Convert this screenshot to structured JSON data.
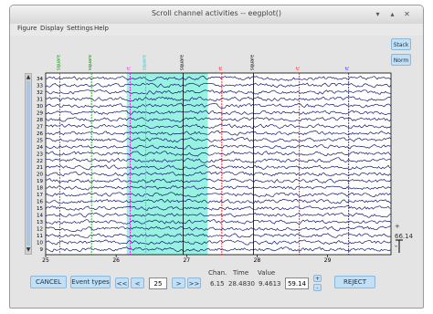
{
  "window": {
    "title": "Scroll channel activities -- eegplot()",
    "minimize": "▾",
    "maximize": "▴",
    "close": "✕"
  },
  "menu": [
    "Figure",
    "Display",
    "Settings",
    "Help"
  ],
  "events": [
    {
      "label": "square",
      "time": 25.2,
      "color": "#00a000"
    },
    {
      "label": "square",
      "time": 25.65,
      "color": "#00a000"
    },
    {
      "label": "rt",
      "time": 26.2,
      "color": "#ff00ff"
    },
    {
      "label": "square",
      "time": 26.42,
      "color": "#3ac8c8"
    },
    {
      "label": "square",
      "time": 26.95,
      "color": "#000000"
    },
    {
      "label": "rt",
      "time": 27.5,
      "color": "#ff0000"
    },
    {
      "label": "square",
      "time": 27.95,
      "color": "#000000"
    },
    {
      "label": "rt",
      "time": 28.6,
      "color": "#ff0000"
    },
    {
      "label": "rt",
      "time": 29.3,
      "color": "#0000ff"
    }
  ],
  "channels": [
    "34",
    "33",
    "32",
    "31",
    "30",
    "29",
    "28",
    "27",
    "26",
    "25",
    "24",
    "23",
    "22",
    "21",
    "20",
    "19",
    "18",
    "17",
    "16",
    "15",
    "14",
    "13",
    "12",
    "11",
    "10",
    "9"
  ],
  "x_axis": {
    "ticks": [
      "25",
      "26",
      "27",
      "28",
      "29"
    ],
    "range": [
      25,
      29.9
    ]
  },
  "selection": {
    "start": 26.15,
    "end": 27.3,
    "color": "#86f0dc"
  },
  "side_buttons": {
    "norm": "Norm",
    "stack": "Stack"
  },
  "scale": {
    "value": "66.14",
    "plus": "+",
    "minus": "-"
  },
  "bottom": {
    "cancel": "CANCEL",
    "event_types": "Event types",
    "nav": [
      "<<",
      "<",
      ">",
      ">>"
    ],
    "time_field": "25",
    "chan_label": "Chan.",
    "time_label": "Time",
    "value_label": "Value",
    "chan_value": "6.15",
    "time_value": "28.4830",
    "value_value": "9.4613",
    "scale_field": "59.14",
    "reject": "REJECT"
  }
}
